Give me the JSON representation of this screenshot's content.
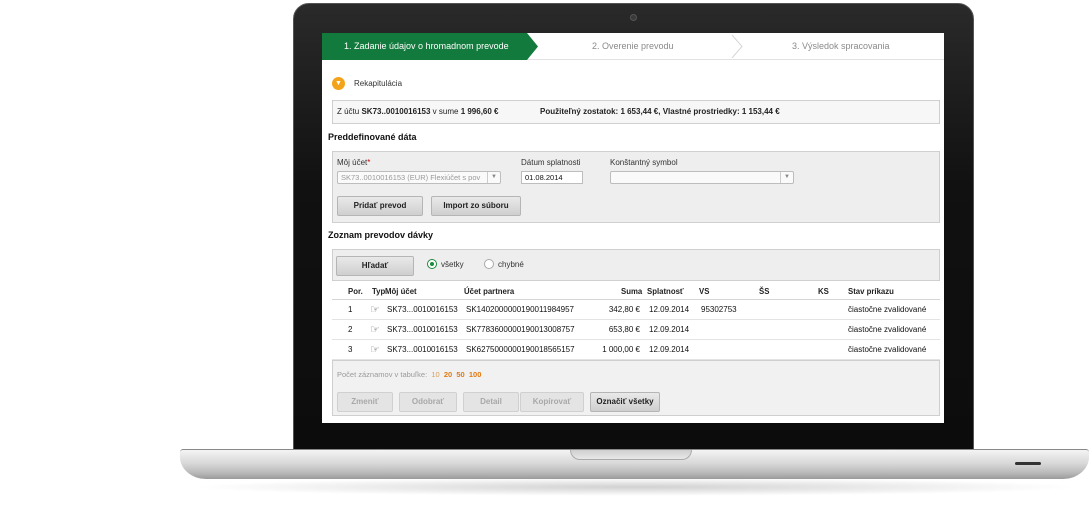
{
  "steps": [
    {
      "label": "1. Zadanie údajov o hromadnom prevode",
      "active": true
    },
    {
      "label": "2. Overenie prevodu",
      "active": false
    },
    {
      "label": "3. Výsledok spracovania",
      "active": false
    }
  ],
  "recap": {
    "label": "Rekapitulácia",
    "icon": "chevron-down-icon"
  },
  "summary": {
    "prefix": "Z účtu",
    "account": "SK73..0010016153",
    "mid": "v sume",
    "amount": "1 996,60 €",
    "available_label": "Použiteľný zostatok:",
    "available_value": "1 653,44 €",
    "own_label": ", Vlastné prostriedky:",
    "own_value": "1 153,44 €"
  },
  "predefined": {
    "title": "Preddefinované dáta",
    "account_label": "Môj účet",
    "required_mark": "*",
    "account_value": "SK73..0010016153 (EUR) Flexiúčet s pov",
    "due_label": "Dátum splatnosti",
    "due_value": "01.08.2014",
    "ks_label": "Konštantný symbol",
    "ks_value": "",
    "add_button": "Pridať prevod",
    "import_button": "Import zo súboru"
  },
  "list": {
    "title": "Zoznam prevodov dávky",
    "search_button": "Hľadať",
    "filter_all": "všetky",
    "filter_errors": "chybné",
    "columns": [
      "Por.",
      "Typ",
      "Môj účet",
      "Účet partnera",
      "Suma",
      "Splatnosť",
      "VS",
      "ŠS",
      "KS",
      "Stav príkazu"
    ],
    "rows": [
      {
        "por": "1",
        "account": "SK73...0010016153",
        "partner": "SK1402000000190011984957",
        "amount": "342,80 €",
        "due": "12.09.2014",
        "vs": "95302753",
        "ss": "",
        "ks": "",
        "status": "čiastočne zvalidované"
      },
      {
        "por": "2",
        "account": "SK73...0010016153",
        "partner": "SK7783600000190013008757",
        "amount": "653,80 €",
        "due": "12.09.2014",
        "vs": "",
        "ss": "",
        "ks": "",
        "status": "čiastočne zvalidované"
      },
      {
        "por": "3",
        "account": "SK73...0010016153",
        "partner": "SK6275000000190018565157",
        "amount": "1 000,00 €",
        "due": "12.09.2014",
        "vs": "",
        "ss": "",
        "ks": "",
        "status": "čiastočne zvalidované"
      }
    ],
    "pager_label": "Počet záznamov v tabuľke:",
    "pager_options": [
      "10",
      "20",
      "50",
      "100"
    ],
    "actions": {
      "change": "Zmeniť",
      "remove": "Odobrať",
      "detail": "Detail",
      "copy": "Kopírovať",
      "select_all": "Označiť všetky"
    }
  },
  "colors": {
    "accent": "#117a3c",
    "recap_icon": "#f3a31a",
    "pager_highlight": "#e07a10"
  }
}
